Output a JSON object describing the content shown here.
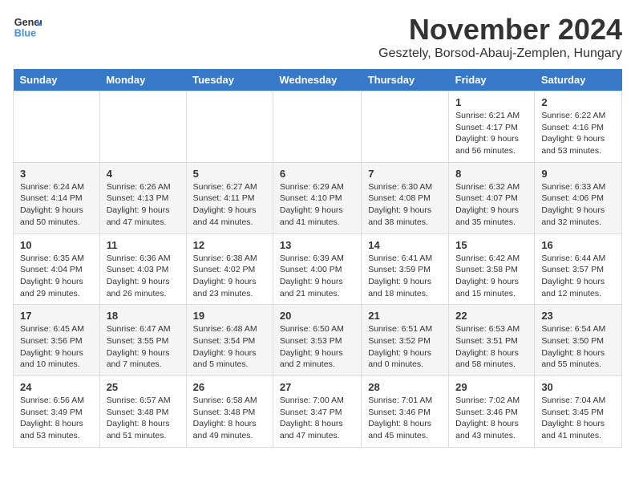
{
  "header": {
    "logo_line1": "General",
    "logo_line2": "Blue",
    "month_title": "November 2024",
    "subtitle": "Gesztely, Borsod-Abauj-Zemplen, Hungary"
  },
  "days_of_week": [
    "Sunday",
    "Monday",
    "Tuesday",
    "Wednesday",
    "Thursday",
    "Friday",
    "Saturday"
  ],
  "weeks": [
    [
      {
        "day": "",
        "info": ""
      },
      {
        "day": "",
        "info": ""
      },
      {
        "day": "",
        "info": ""
      },
      {
        "day": "",
        "info": ""
      },
      {
        "day": "",
        "info": ""
      },
      {
        "day": "1",
        "info": "Sunrise: 6:21 AM\nSunset: 4:17 PM\nDaylight: 9 hours and 56 minutes."
      },
      {
        "day": "2",
        "info": "Sunrise: 6:22 AM\nSunset: 4:16 PM\nDaylight: 9 hours and 53 minutes."
      }
    ],
    [
      {
        "day": "3",
        "info": "Sunrise: 6:24 AM\nSunset: 4:14 PM\nDaylight: 9 hours and 50 minutes."
      },
      {
        "day": "4",
        "info": "Sunrise: 6:26 AM\nSunset: 4:13 PM\nDaylight: 9 hours and 47 minutes."
      },
      {
        "day": "5",
        "info": "Sunrise: 6:27 AM\nSunset: 4:11 PM\nDaylight: 9 hours and 44 minutes."
      },
      {
        "day": "6",
        "info": "Sunrise: 6:29 AM\nSunset: 4:10 PM\nDaylight: 9 hours and 41 minutes."
      },
      {
        "day": "7",
        "info": "Sunrise: 6:30 AM\nSunset: 4:08 PM\nDaylight: 9 hours and 38 minutes."
      },
      {
        "day": "8",
        "info": "Sunrise: 6:32 AM\nSunset: 4:07 PM\nDaylight: 9 hours and 35 minutes."
      },
      {
        "day": "9",
        "info": "Sunrise: 6:33 AM\nSunset: 4:06 PM\nDaylight: 9 hours and 32 minutes."
      }
    ],
    [
      {
        "day": "10",
        "info": "Sunrise: 6:35 AM\nSunset: 4:04 PM\nDaylight: 9 hours and 29 minutes."
      },
      {
        "day": "11",
        "info": "Sunrise: 6:36 AM\nSunset: 4:03 PM\nDaylight: 9 hours and 26 minutes."
      },
      {
        "day": "12",
        "info": "Sunrise: 6:38 AM\nSunset: 4:02 PM\nDaylight: 9 hours and 23 minutes."
      },
      {
        "day": "13",
        "info": "Sunrise: 6:39 AM\nSunset: 4:00 PM\nDaylight: 9 hours and 21 minutes."
      },
      {
        "day": "14",
        "info": "Sunrise: 6:41 AM\nSunset: 3:59 PM\nDaylight: 9 hours and 18 minutes."
      },
      {
        "day": "15",
        "info": "Sunrise: 6:42 AM\nSunset: 3:58 PM\nDaylight: 9 hours and 15 minutes."
      },
      {
        "day": "16",
        "info": "Sunrise: 6:44 AM\nSunset: 3:57 PM\nDaylight: 9 hours and 12 minutes."
      }
    ],
    [
      {
        "day": "17",
        "info": "Sunrise: 6:45 AM\nSunset: 3:56 PM\nDaylight: 9 hours and 10 minutes."
      },
      {
        "day": "18",
        "info": "Sunrise: 6:47 AM\nSunset: 3:55 PM\nDaylight: 9 hours and 7 minutes."
      },
      {
        "day": "19",
        "info": "Sunrise: 6:48 AM\nSunset: 3:54 PM\nDaylight: 9 hours and 5 minutes."
      },
      {
        "day": "20",
        "info": "Sunrise: 6:50 AM\nSunset: 3:53 PM\nDaylight: 9 hours and 2 minutes."
      },
      {
        "day": "21",
        "info": "Sunrise: 6:51 AM\nSunset: 3:52 PM\nDaylight: 9 hours and 0 minutes."
      },
      {
        "day": "22",
        "info": "Sunrise: 6:53 AM\nSunset: 3:51 PM\nDaylight: 8 hours and 58 minutes."
      },
      {
        "day": "23",
        "info": "Sunrise: 6:54 AM\nSunset: 3:50 PM\nDaylight: 8 hours and 55 minutes."
      }
    ],
    [
      {
        "day": "24",
        "info": "Sunrise: 6:56 AM\nSunset: 3:49 PM\nDaylight: 8 hours and 53 minutes."
      },
      {
        "day": "25",
        "info": "Sunrise: 6:57 AM\nSunset: 3:48 PM\nDaylight: 8 hours and 51 minutes."
      },
      {
        "day": "26",
        "info": "Sunrise: 6:58 AM\nSunset: 3:48 PM\nDaylight: 8 hours and 49 minutes."
      },
      {
        "day": "27",
        "info": "Sunrise: 7:00 AM\nSunset: 3:47 PM\nDaylight: 8 hours and 47 minutes."
      },
      {
        "day": "28",
        "info": "Sunrise: 7:01 AM\nSunset: 3:46 PM\nDaylight: 8 hours and 45 minutes."
      },
      {
        "day": "29",
        "info": "Sunrise: 7:02 AM\nSunset: 3:46 PM\nDaylight: 8 hours and 43 minutes."
      },
      {
        "day": "30",
        "info": "Sunrise: 7:04 AM\nSunset: 3:45 PM\nDaylight: 8 hours and 41 minutes."
      }
    ]
  ]
}
